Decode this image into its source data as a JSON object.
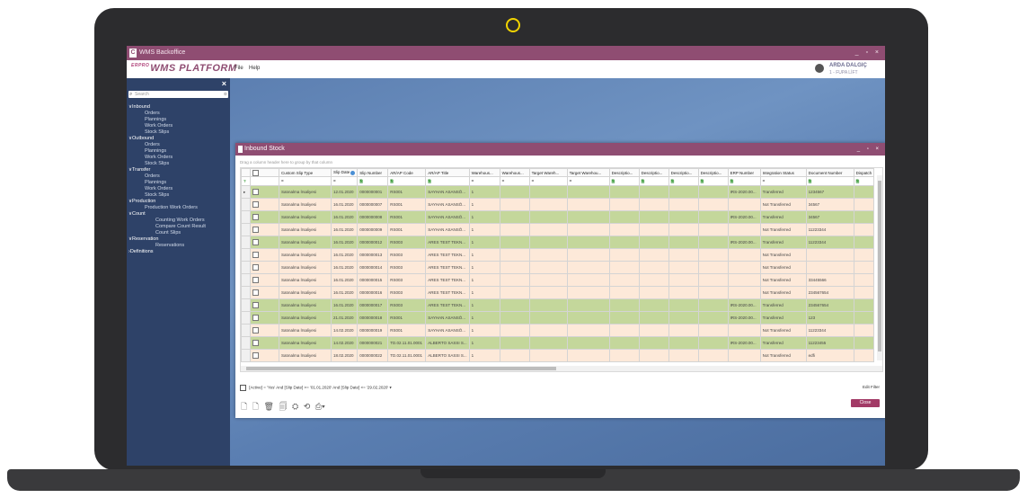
{
  "window": {
    "title": "WMS Backoffice",
    "controls": "_ ▫ ×"
  },
  "app": {
    "logo_small": "ERPRO",
    "logo": "WMS PLATFORM",
    "menu": [
      "File",
      "Help"
    ],
    "user_name": "ARDA DALGIÇ",
    "user_company": "1 - FUPA LİFT"
  },
  "sidebar": {
    "close": "×",
    "search_placeholder": "Search",
    "nav": [
      {
        "type": "group",
        "label": "∨Inbound"
      },
      {
        "type": "item",
        "label": "Orders"
      },
      {
        "type": "item",
        "label": "Plannings"
      },
      {
        "type": "item",
        "label": "Work Orders"
      },
      {
        "type": "item",
        "label": "Stock Slips"
      },
      {
        "type": "group",
        "label": "∨Outbound"
      },
      {
        "type": "item",
        "label": "Orders"
      },
      {
        "type": "item",
        "label": "Plannings"
      },
      {
        "type": "item",
        "label": "Work Orders"
      },
      {
        "type": "item",
        "label": "Stock Slips"
      },
      {
        "type": "group",
        "label": "∨Transfer"
      },
      {
        "type": "item",
        "label": "Orders"
      },
      {
        "type": "item",
        "label": "Plannings"
      },
      {
        "type": "item",
        "label": "Work Orders"
      },
      {
        "type": "item",
        "label": "Stock Slips"
      },
      {
        "type": "group",
        "label": "∨Production"
      },
      {
        "type": "item",
        "label": "Production Work Orders"
      },
      {
        "type": "group",
        "label": "∨Count"
      },
      {
        "type": "item2",
        "label": "Counting Work Orders"
      },
      {
        "type": "item2",
        "label": "Compare Count Result"
      },
      {
        "type": "item2",
        "label": "Count Slips"
      },
      {
        "type": "group",
        "label": "∨Reservation"
      },
      {
        "type": "item2",
        "label": "Reservations"
      },
      {
        "type": "group",
        "label": "›Definitions"
      }
    ]
  },
  "inbound": {
    "title": "Inbound Stock",
    "controls": "_ ▫ ×",
    "group_hint": "Drag a column header here to group by that column",
    "columns": [
      "",
      "",
      "Custom Slip Type",
      "Slip Date",
      "Slip Number",
      "AR/AP Code",
      "AR/AP Title",
      "Warehous...",
      "Warehous...",
      "Target Wareh...",
      "Target Warehou...",
      "Descriptio...",
      "Descriptio...",
      "Descriptio...",
      "Descriptio...",
      "ERP Number",
      "Integration Status",
      "Document Number",
      "Dispatch"
    ],
    "filter_row": [
      "?",
      "",
      "=",
      "=",
      "🗎",
      "🗎",
      "🗎",
      "=",
      "=",
      "=",
      "=",
      "🗎",
      "🗎",
      "🗎",
      "🗎",
      "🗎",
      "=",
      "🗎",
      "🗎"
    ],
    "rows": [
      {
        "color": "g",
        "cells": [
          "▸",
          "",
          "Satınalma İrsaliyesi",
          "12.01.2020",
          "0000000001",
          "RS001",
          "SAYHAN ASANSÖ...",
          "1",
          "",
          "",
          "",
          "",
          "",
          "",
          "",
          "IRS-2020.00...",
          "Transferred",
          "1234567",
          ""
        ]
      },
      {
        "color": "p",
        "cells": [
          "",
          "",
          "Satınalma İrsaliyesi",
          "16.01.2020",
          "0000000007",
          "RS001",
          "SAYHAN ASANSÖ...",
          "1",
          "",
          "",
          "",
          "",
          "",
          "",
          "",
          "",
          "Not Transferred",
          "34567",
          ""
        ]
      },
      {
        "color": "g",
        "cells": [
          "",
          "",
          "Satınalma İrsaliyesi",
          "16.01.2020",
          "0000000008",
          "RS001",
          "SAYHAN ASANSÖ...",
          "1",
          "",
          "",
          "",
          "",
          "",
          "",
          "",
          "IRS-2020.00...",
          "Transferred",
          "34567",
          ""
        ]
      },
      {
        "color": "p",
        "cells": [
          "",
          "",
          "Satınalma İrsaliyesi",
          "16.01.2020",
          "0000000009",
          "RS001",
          "SAYHAN ASANSÖ...",
          "1",
          "",
          "",
          "",
          "",
          "",
          "",
          "",
          "",
          "Not Transferred",
          "11223344",
          ""
        ]
      },
      {
        "color": "g",
        "cells": [
          "",
          "",
          "Satınalma İrsaliyesi",
          "16.01.2020",
          "0000000012",
          "RS003",
          "ARES TEST TEKN...",
          "1",
          "",
          "",
          "",
          "",
          "",
          "",
          "",
          "IRS-2020.00...",
          "Transferred",
          "11223344",
          ""
        ]
      },
      {
        "color": "p",
        "cells": [
          "",
          "",
          "Satınalma İrsaliyesi",
          "16.01.2020",
          "0000000013",
          "RS003",
          "ARES TEST TEKN...",
          "1",
          "",
          "",
          "",
          "",
          "",
          "",
          "",
          "",
          "Not Transferred",
          "",
          ""
        ]
      },
      {
        "color": "p",
        "cells": [
          "",
          "",
          "Satınalma İrsaliyesi",
          "16.01.2020",
          "0000000014",
          "RS003",
          "ARES TEST TEKN...",
          "1",
          "",
          "",
          "",
          "",
          "",
          "",
          "",
          "",
          "Not Transferred",
          "",
          ""
        ]
      },
      {
        "color": "p",
        "cells": [
          "",
          "",
          "Satınalma İrsaliyesi",
          "16.01.2020",
          "0000000015",
          "RS003",
          "ARES TEST TEKN...",
          "1",
          "",
          "",
          "",
          "",
          "",
          "",
          "",
          "",
          "Not Transferred",
          "33445566",
          ""
        ]
      },
      {
        "color": "p",
        "cells": [
          "",
          "",
          "Satınalma İrsaliyesi",
          "16.01.2020",
          "0000000016",
          "RS003",
          "ARES TEST TEKN...",
          "1",
          "",
          "",
          "",
          "",
          "",
          "",
          "",
          "",
          "Not Transferred",
          "234567654",
          ""
        ]
      },
      {
        "color": "g",
        "cells": [
          "",
          "",
          "Satınalma İrsaliyesi",
          "16.01.2020",
          "0000000017",
          "RS003",
          "ARES TEST TEKN...",
          "1",
          "",
          "",
          "",
          "",
          "",
          "",
          "",
          "IRS-2020.00...",
          "Transferred",
          "234567654",
          ""
        ]
      },
      {
        "color": "g",
        "cells": [
          "",
          "",
          "Satınalma İrsaliyesi",
          "21.01.2020",
          "0000000018",
          "RS001",
          "SAYHAN ASANSÖ...",
          "1",
          "",
          "",
          "",
          "",
          "",
          "",
          "",
          "IRS-2020.00...",
          "Transferred",
          "123",
          ""
        ]
      },
      {
        "color": "p",
        "cells": [
          "",
          "",
          "Satınalma İrsaliyesi",
          "14.02.2020",
          "0000000019",
          "RS001",
          "SAYHAN ASANSÖ...",
          "1",
          "",
          "",
          "",
          "",
          "",
          "",
          "",
          "",
          "Not Transferred",
          "11223344",
          ""
        ]
      },
      {
        "color": "g",
        "cells": [
          "",
          "",
          "Satınalma İrsaliyesi",
          "14.02.2020",
          "0000000021",
          "TD.02.11.01.0001",
          "ALBERTO SASSI S...",
          "1",
          "",
          "",
          "",
          "",
          "",
          "",
          "",
          "IRS-2020.00...",
          "Transferred",
          "11223455",
          ""
        ]
      },
      {
        "color": "p",
        "cells": [
          "",
          "",
          "Satınalma İrsaliyesi",
          "18.02.2020",
          "0000000022",
          "TD.02.11.01.0001",
          "ALBERTO SASSI S...",
          "1",
          "",
          "",
          "",
          "",
          "",
          "",
          "",
          "",
          "Not Transferred",
          "edfi",
          ""
        ]
      }
    ],
    "filter_text": "[Active] = 'Yes' And [Slip Date] >= '01.01.2020' And [Slip Date] <= '29.02.2020'",
    "filter_dropdown": "▾",
    "edit_filter": "Edit Filter",
    "toolbar_icons": [
      "🗋",
      "🗋",
      "🗑",
      "🗐",
      "⛭",
      "⟲",
      "⎙▾"
    ],
    "close_label": "Close"
  }
}
